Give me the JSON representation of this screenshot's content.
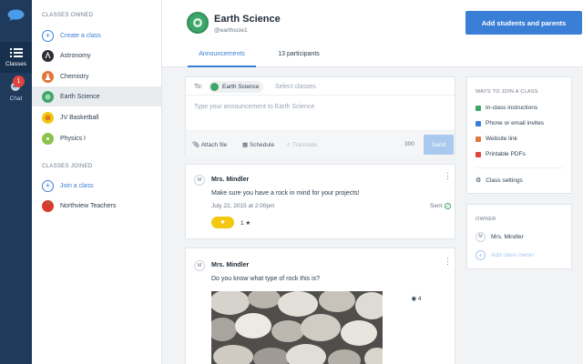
{
  "rail": {
    "items": [
      {
        "label": "Classes",
        "icon": "list-icon"
      },
      {
        "label": "Chat",
        "icon": "chat-icon",
        "badge": "1"
      }
    ]
  },
  "sidebar": {
    "owned_title": "CLASSES OWNED",
    "create_label": "Create a class",
    "owned": [
      {
        "label": "Astronomy",
        "icon": "astronomy-icon"
      },
      {
        "label": "Chemistry",
        "icon": "chemistry-icon"
      },
      {
        "label": "Earth Science",
        "icon": "earth-science-icon"
      },
      {
        "label": "JV Basketball",
        "icon": "basketball-icon"
      },
      {
        "label": "Physics I",
        "icon": "physics-icon"
      }
    ],
    "joined_title": "CLASSES JOINED",
    "join_label": "Join a class",
    "joined": [
      {
        "label": "Northview Teachers",
        "icon": "apple-icon"
      }
    ]
  },
  "header": {
    "title": "Earth Science",
    "handle": "@earthscie1",
    "add_button": "Add students and parents",
    "tabs": [
      {
        "label": "Announcements",
        "active": true
      },
      {
        "label": "13 participants",
        "active": false
      }
    ]
  },
  "composer": {
    "to_label": "To:",
    "chip_label": "Earth Science",
    "select_placeholder": "Select classes",
    "placeholder": "Type your announcement to Earth Science",
    "attach_label": "Attach file",
    "schedule_label": "Schedule",
    "translate_label": "Translate",
    "char_count": "300",
    "send_label": "Send"
  },
  "posts": [
    {
      "avatar": "M",
      "author": "Mrs. Mindler",
      "body": "Make sure you have a rock in mind for your projects!",
      "date": "July 22, 2015 at 2:00pm",
      "status": "Sent",
      "reactions": "1 ★"
    },
    {
      "avatar": "M",
      "author": "Mrs. Mindler",
      "body": "Do you know what type of rock this is?",
      "views": "4"
    }
  ],
  "right": {
    "ways_title": "WAYS TO JOIN A CLASS",
    "ways": [
      {
        "label": "In-class instructions",
        "color": "#3fa66a"
      },
      {
        "label": "Phone or email invites",
        "color": "#3a7fd5"
      },
      {
        "label": "Website link",
        "color": "#e0773e"
      },
      {
        "label": "Printable PDFs",
        "color": "#e0443e"
      }
    ],
    "settings_label": "Class settings",
    "owner_title": "OWNER",
    "owner_name": "Mrs. Mindler",
    "owner_avatar": "M",
    "add_owner_label": "Add class owner"
  },
  "colors": {
    "accent": "#3a7fd5",
    "rail": "#1f3a5b",
    "success": "#3fa66a",
    "badge": "#e0443e"
  }
}
